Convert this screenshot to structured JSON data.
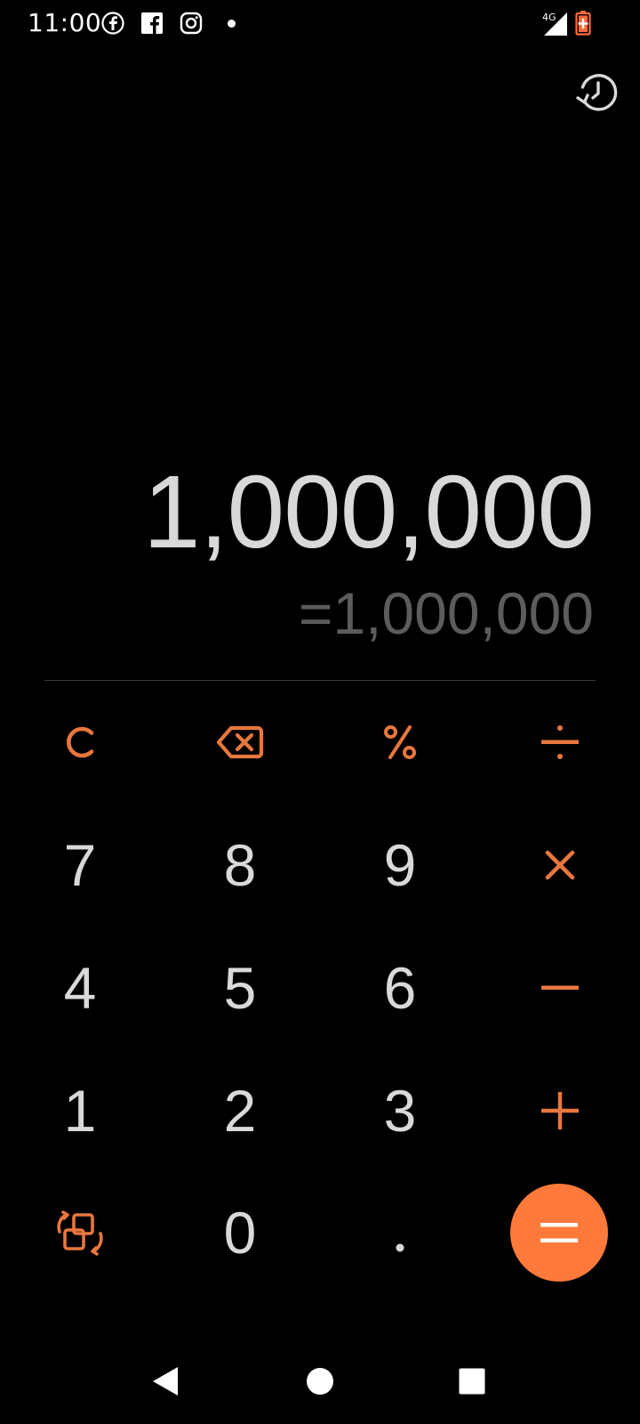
{
  "status_bar": {
    "time": "11:00",
    "network": "4G",
    "icons": [
      "facebook-messenger-icon",
      "facebook-icon",
      "instagram-icon",
      "notification-dot-icon",
      "signal-icon",
      "battery-saver-icon"
    ]
  },
  "display": {
    "expression": "1,000,000",
    "result": "=1,000,000"
  },
  "keypad": {
    "clear": "C",
    "percent": "%",
    "divide": "÷",
    "multiply": "×",
    "minus": "−",
    "plus": "+",
    "decimal": ".",
    "digits": {
      "d0": "0",
      "d1": "1",
      "d2": "2",
      "d3": "3",
      "d4": "4",
      "d5": "5",
      "d6": "6",
      "d7": "7",
      "d8": "8",
      "d9": "9"
    }
  },
  "colors": {
    "background": "#000000",
    "accent": "#e8773e",
    "equals_bg": "#ff7a3a",
    "digit": "#d9d9d9",
    "result": "#5c5c5c"
  }
}
